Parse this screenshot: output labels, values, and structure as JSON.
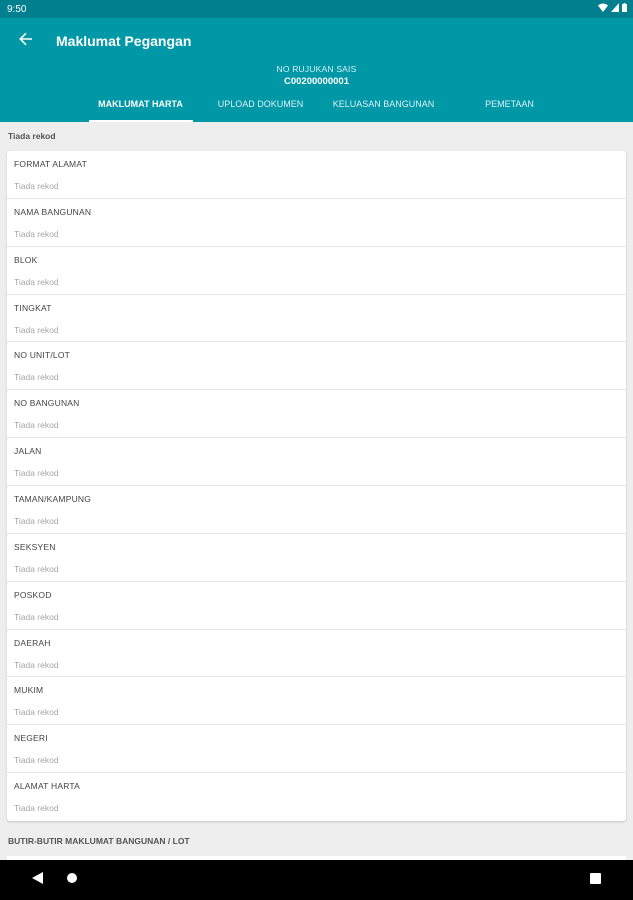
{
  "status_bar": {
    "time": "9:50"
  },
  "toolbar": {
    "title": "Maklumat Pegangan"
  },
  "reference": {
    "label": "NO RUJUKAN SAIS",
    "value": "C00200000001"
  },
  "tabs": [
    {
      "label": "MAKLUMAT HARTA",
      "active": true
    },
    {
      "label": "UPLOAD DOKUMEN",
      "active": false
    },
    {
      "label": "KELUASAN BANGUNAN",
      "active": false
    },
    {
      "label": "PEMETAAN",
      "active": false
    }
  ],
  "sections": {
    "first_header": "Tiada rekod",
    "second_header": "BUTIR-BUTIR MAKLUMAT BANGUNAN / LOT"
  },
  "fields": [
    {
      "label": "FORMAT ALAMAT",
      "value": "Tiada rekod"
    },
    {
      "label": "NAMA BANGUNAN",
      "value": "Tiada rekod"
    },
    {
      "label": "BLOK",
      "value": "Tiada rekod"
    },
    {
      "label": "TINGKAT",
      "value": "Tiada rekod"
    },
    {
      "label": "NO UNIT/LOT",
      "value": "Tiada rekod"
    },
    {
      "label": "NO BANGUNAN",
      "value": "Tiada rekod"
    },
    {
      "label": "JALAN",
      "value": "Tiada rekod"
    },
    {
      "label": "TAMAN/KAMPUNG",
      "value": "Tiada rekod"
    },
    {
      "label": "SEKSYEN",
      "value": "Tiada rekod"
    },
    {
      "label": "POSKOD",
      "value": "Tiada rekod"
    },
    {
      "label": "DAERAH",
      "value": "Tiada rekod"
    },
    {
      "label": "MUKIM",
      "value": "Tiada rekod"
    },
    {
      "label": "NEGERI",
      "value": "Tiada rekod"
    },
    {
      "label": "ALAMAT HARTA",
      "value": "Tiada rekod"
    }
  ],
  "icons": {
    "back": "arrow-back-icon",
    "wifi": "wifi-icon",
    "signal": "signal-icon",
    "battery": "battery-icon",
    "nav_back": "nav-back-icon",
    "nav_home": "nav-home-icon",
    "nav_recents": "nav-recents-icon"
  },
  "colors": {
    "app_bar": "#0097a7",
    "status_bar": "#007f8f",
    "background": "#eeeeee"
  }
}
